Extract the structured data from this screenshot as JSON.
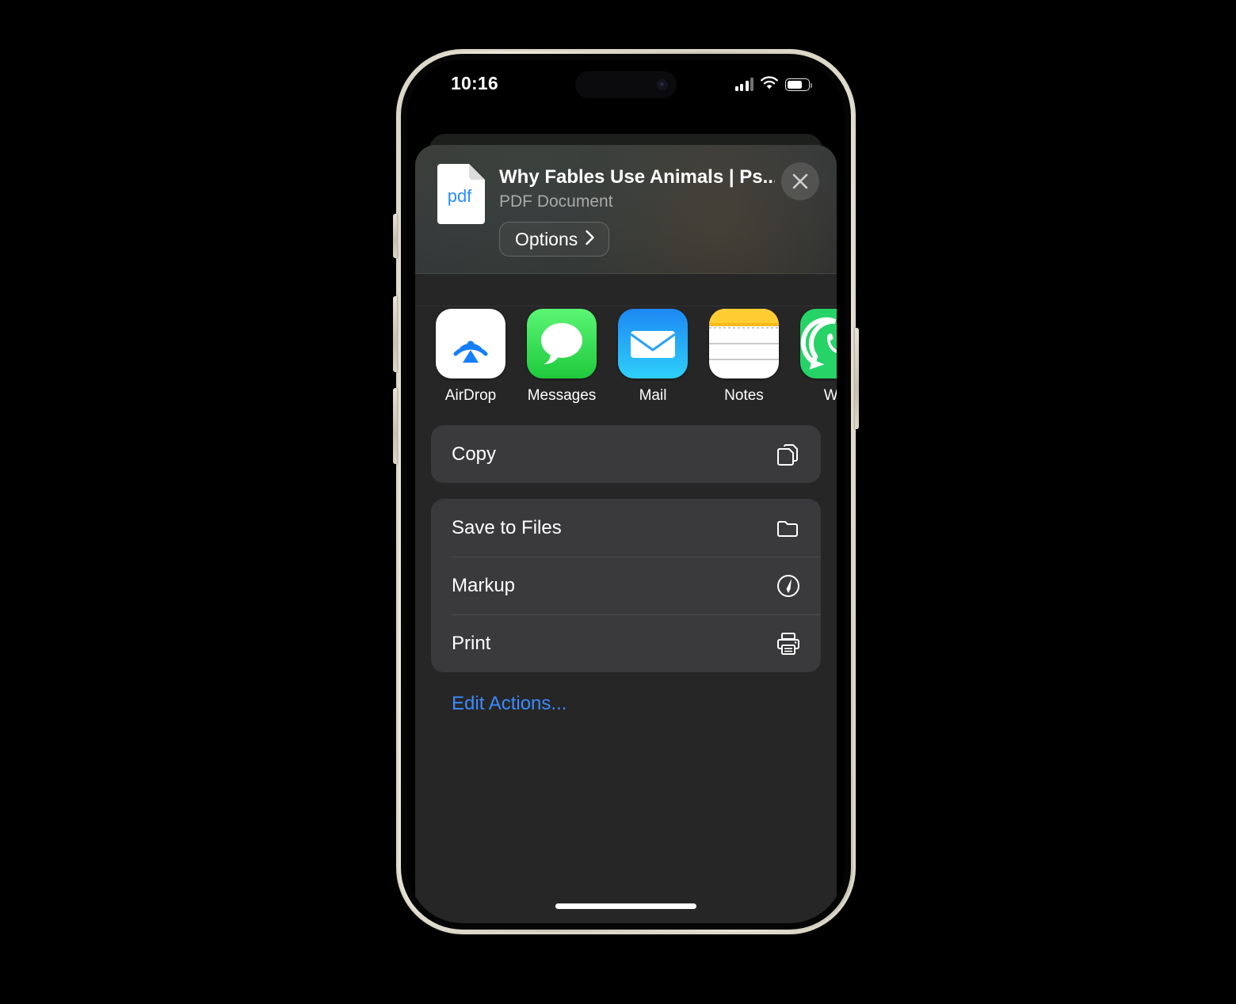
{
  "status_bar": {
    "time": "10:16",
    "cellular_icon": "cellular-bars-icon",
    "wifi_icon": "wifi-icon",
    "battery_icon": "battery-icon",
    "battery_level_percent": 62
  },
  "share_sheet": {
    "file": {
      "icon": "pdf-file-icon",
      "icon_label": "pdf",
      "title": "Why Fables Use Animals | Ps...",
      "subtitle": "PDF Document"
    },
    "options_button": {
      "label": "Options",
      "chevron_icon": "chevron-right-icon"
    },
    "close_button": {
      "icon": "close-icon"
    },
    "apps": [
      {
        "name": "AirDrop",
        "icon": "airdrop-icon"
      },
      {
        "name": "Messages",
        "icon": "messages-icon"
      },
      {
        "name": "Mail",
        "icon": "mail-icon"
      },
      {
        "name": "Notes",
        "icon": "notes-icon"
      },
      {
        "name": "Wh",
        "icon": "whatsapp-icon"
      }
    ],
    "action_groups": [
      {
        "rows": [
          {
            "label": "Copy",
            "icon": "copy-icon"
          }
        ]
      },
      {
        "rows": [
          {
            "label": "Save to Files",
            "icon": "folder-icon"
          },
          {
            "label": "Markup",
            "icon": "markup-pen-icon"
          },
          {
            "label": "Print",
            "icon": "printer-icon"
          }
        ]
      }
    ],
    "edit_actions_label": "Edit Actions...",
    "colors": {
      "sheet_background": "#262626",
      "group_background": "#3a3a3c",
      "accent_blue": "#3b8aff",
      "subtitle_gray": "#a9aaa9"
    }
  },
  "home_indicator": "home-indicator"
}
